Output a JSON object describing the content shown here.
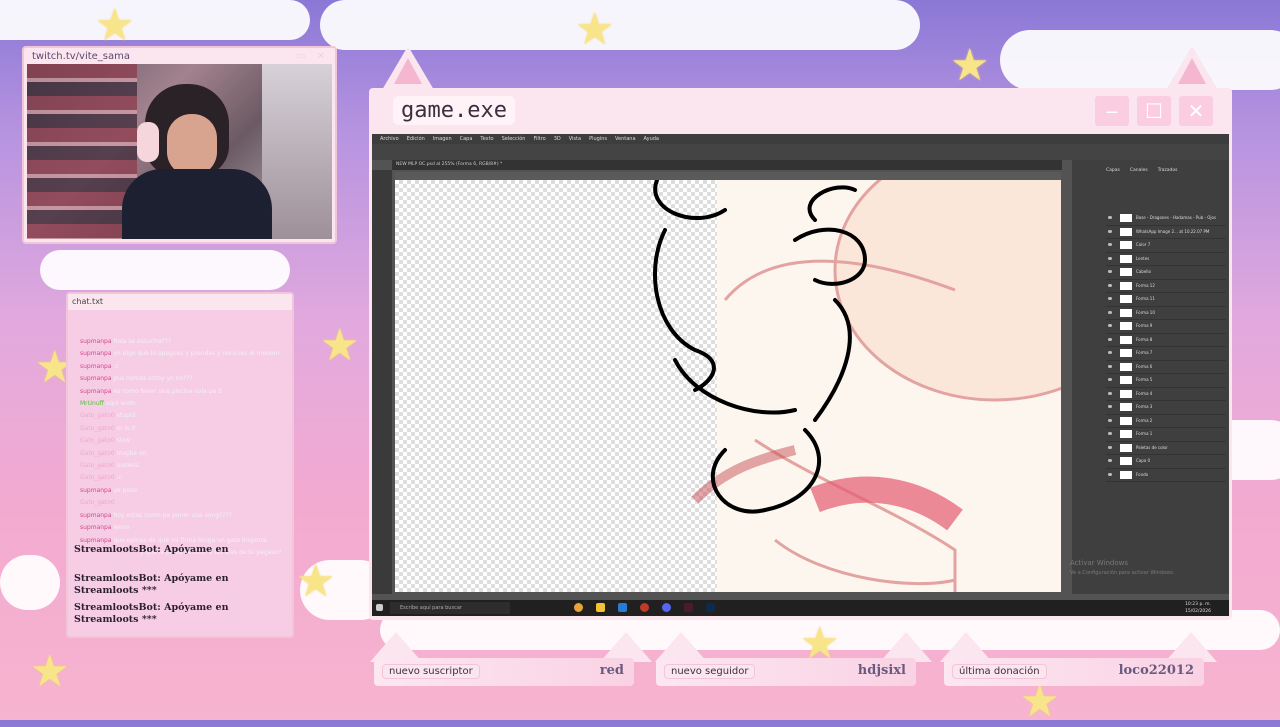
{
  "webcam": {
    "url": "twitch.tv/vite_sama"
  },
  "chat": {
    "title": "chat.txt",
    "lines": [
      {
        "user": "supmanpa",
        "text": "hola se escucha???",
        "cls": "u1"
      },
      {
        "user": "supmanpa",
        "text": "yo digo que lo apagues y prendas y reinicies el modem",
        "cls": "u1"
      },
      {
        "user": "supmanpa",
        "text": ":c",
        "cls": "u1"
      },
      {
        "user": "supmanpa",
        "text": "pus nomas estoy yo no???",
        "cls": "u1"
      },
      {
        "user": "supmanpa",
        "text": "es como tener una piscina sola pa ti",
        "cls": "u1"
      },
      {
        "user": "MrUnuff",
        "text": "aqui ando",
        "cls": "u2"
      },
      {
        "user": "Gato_gato0",
        "text": "stupid",
        "cls": "u3"
      },
      {
        "user": "Gato_gato0",
        "text": "or is it",
        "cls": "u3"
      },
      {
        "user": "Gato_gato0",
        "text": "slow",
        "cls": "u3"
      },
      {
        "user": "Gato_gato0",
        "text": "maybe im",
        "cls": "u3"
      },
      {
        "user": "Gato_gato0",
        "text": "useless",
        "cls": "u3"
      },
      {
        "user": "Gato_gato0",
        "text": ":c",
        "cls": "u3"
      },
      {
        "user": "supmanpa",
        "text": "ye paso",
        "cls": "u1"
      },
      {
        "user": "Gato_gato0",
        "text": "",
        "cls": "u3"
      },
      {
        "user": "supmanpa",
        "text": "hoy estas como pa poner una song????",
        "cls": "u1"
      },
      {
        "user": "supmanpa",
        "text": "weno",
        "cls": "u1"
      },
      {
        "user": "supmanpa",
        "text": "que opinas de que mi firma tenga un gato limpiota",
        "cls": "u1"
      }
    ],
    "overlap_text": "y que le pondras color a las alas de tu pegaso?",
    "bot_messages": [
      "StreamlootsBot: Apóyame en",
      "StreamlootsBot: Apóyame en Streamloots ***",
      "StreamlootsBot: Apóyame en Streamloots ***"
    ]
  },
  "game": {
    "title": "game.exe",
    "menu": [
      "Archivo",
      "Edición",
      "Imagen",
      "Capa",
      "Texto",
      "Selección",
      "Filtro",
      "3D",
      "Vista",
      "Plugins",
      "Ventana",
      "Ayuda"
    ],
    "doc_tab": "NEW MLP OC.psd al 255% (Forma 6, RGB/8#) *",
    "panel_tabs": [
      "Capas",
      "Canales",
      "Trazados"
    ],
    "layers": [
      "Base - Dragones - Hadamas - Pub - Ojos",
      "WhatsApp Image 2... at 10.22.07 PM",
      "Color 7",
      "Lentes",
      "Cabello",
      "Forma 12",
      "Forma 11",
      "Forma 10",
      "Forma 9",
      "Forma 8",
      "Forma 7",
      "Forma 6",
      "Forma 5",
      "Forma 4",
      "Forma 3",
      "Forma 2",
      "Forma 1",
      "Paletas de color",
      "Capa 0",
      "Fondo"
    ],
    "activate_windows": [
      "Activar Windows",
      "Ve a Configuración para activar Windows."
    ],
    "taskbar_search": "Escribe aquí para buscar",
    "clock": [
      "10:23 p. m.",
      "15/02/2026"
    ]
  },
  "bars": [
    {
      "label": "nuevo suscriptor",
      "value": "red"
    },
    {
      "label": "nuevo seguidor",
      "value": "hdjsixl"
    },
    {
      "label": "última donación",
      "value": "loco22012"
    }
  ]
}
